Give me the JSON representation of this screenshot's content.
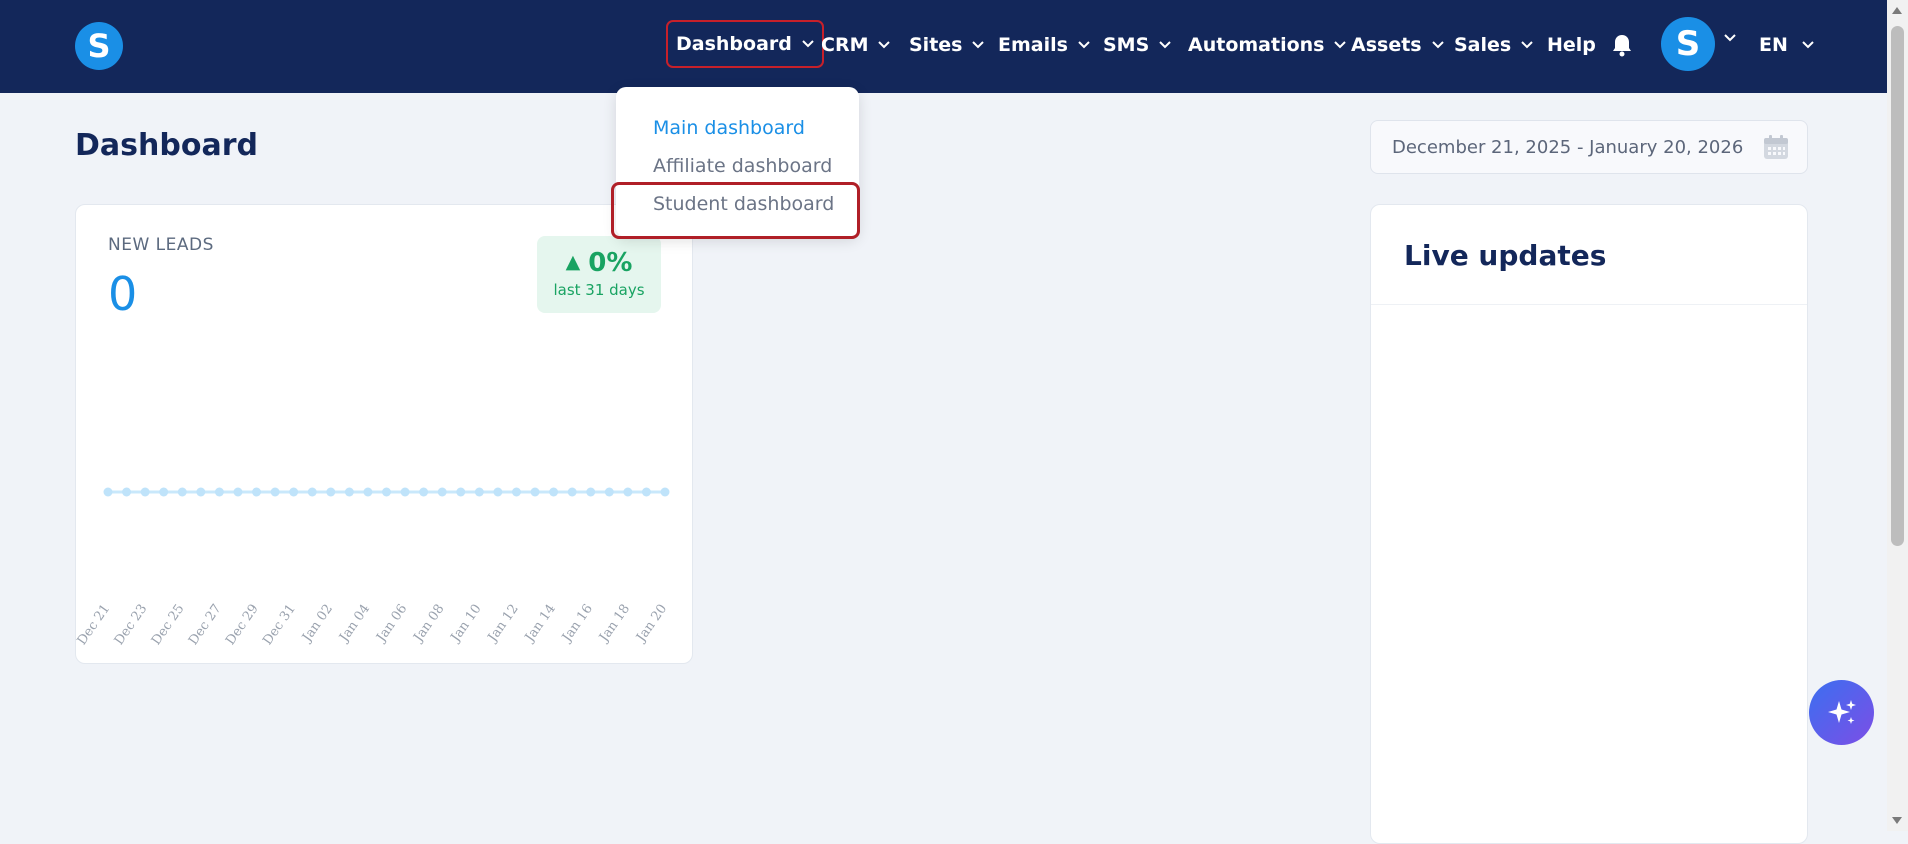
{
  "nav": {
    "logo_letter": "S",
    "items": [
      {
        "label": "Dashboard"
      },
      {
        "label": "CRM"
      },
      {
        "label": "Sites"
      },
      {
        "label": "Emails"
      },
      {
        "label": "SMS"
      },
      {
        "label": "Automations"
      },
      {
        "label": "Assets"
      },
      {
        "label": "Sales"
      },
      {
        "label": "Help"
      }
    ],
    "avatar_letter": "S",
    "language": "EN",
    "icons": [
      "bell-icon",
      "chevron-down-icon"
    ]
  },
  "dropdown": {
    "items": [
      {
        "label": "Main dashboard"
      },
      {
        "label": "Affiliate dashboard"
      },
      {
        "label": "Student dashboard"
      }
    ]
  },
  "page": {
    "title": "Dashboard",
    "date_range": "December 21, 2025 - January 20, 2026"
  },
  "leads_card": {
    "label": "NEW LEADS",
    "value": "0",
    "change": "0%",
    "change_caption": "last 31 days"
  },
  "live_updates": {
    "title": "Live updates"
  },
  "colors": {
    "nav_bg": "#13275a",
    "accent": "#1a8fe6",
    "positive": "#19a362",
    "highlight": "#b01f27"
  },
  "chart_data": {
    "type": "line",
    "x": [
      "Dec 21",
      "Dec 22",
      "Dec 23",
      "Dec 24",
      "Dec 25",
      "Dec 26",
      "Dec 27",
      "Dec 28",
      "Dec 29",
      "Dec 30",
      "Dec 31",
      "Jan 01",
      "Jan 02",
      "Jan 03",
      "Jan 04",
      "Jan 05",
      "Jan 06",
      "Jan 07",
      "Jan 08",
      "Jan 09",
      "Jan 10",
      "Jan 11",
      "Jan 12",
      "Jan 13",
      "Jan 14",
      "Jan 15",
      "Jan 16",
      "Jan 17",
      "Jan 18",
      "Jan 19",
      "Jan 20"
    ],
    "tick_labels": [
      "Dec 21",
      "Dec 23",
      "Dec 25",
      "Dec 27",
      "Dec 29",
      "Dec 31",
      "Jan 02",
      "Jan 04",
      "Jan 06",
      "Jan 08",
      "Jan 10",
      "Jan 12",
      "Jan 14",
      "Jan 16",
      "Jan 18",
      "Jan 20"
    ],
    "series": [
      {
        "values": [
          0,
          0,
          0,
          0,
          0,
          0,
          0,
          0,
          0,
          0,
          0,
          0,
          0,
          0,
          0,
          0,
          0,
          0,
          0,
          0,
          0,
          0,
          0,
          0,
          0,
          0,
          0,
          0,
          0,
          0,
          0
        ]
      }
    ],
    "grid": false
  }
}
